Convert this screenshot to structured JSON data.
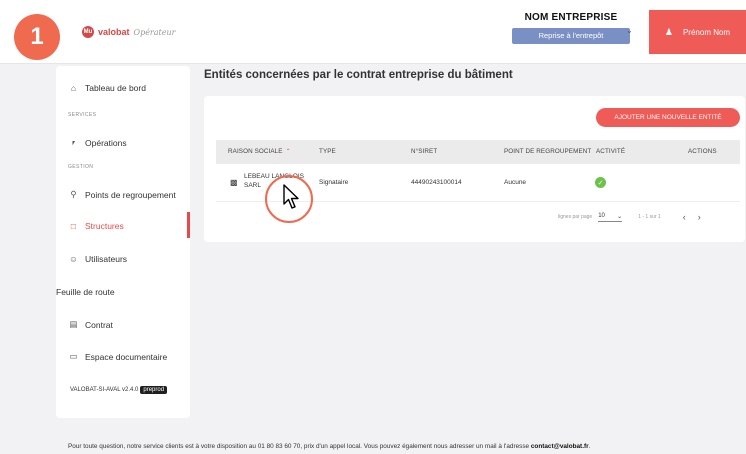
{
  "step_number": "1",
  "logo": {
    "brand": "valobat",
    "mark": "Mu",
    "subtitle": "Opérateur"
  },
  "header": {
    "company_name": "NOM ENTREPRISE",
    "reprise_label": "Reprise à l'entrepôt",
    "user_name": "Prénom Nom"
  },
  "sidebar": {
    "dashboard": "Tableau de bord",
    "section_services": "SERVICES",
    "operations": "Opérations",
    "section_gestion": "GESTION",
    "points": "Points de regroupement",
    "structures": "Structures",
    "users": "Utilisateurs",
    "roadmap": "Feuille de route",
    "contract": "Contrat",
    "documents": "Espace documentaire",
    "version": "VALOBAT-SI-AVAL v2.4.0",
    "version_tag": "preprod"
  },
  "main": {
    "title": "Entités concernées par le contrat entreprise du bâtiment",
    "add_button": "AJOUTER UNE NOUVELLE ENTITÉ",
    "columns": [
      "RAISON SOCIALE",
      "TYPE",
      "N°SIRET",
      "POINT DE REGROUPEMENT",
      "ACTIVITÉ",
      "ACTIONS"
    ],
    "rows": [
      {
        "raison_sociale": "LEBEAU LANGLOIS SARL",
        "type": "Signataire",
        "siret": "44490243100014",
        "point": "Aucune",
        "activite": "active"
      }
    ],
    "pagination": {
      "rows_per_page_label": "lignes par page",
      "rows_per_page": "10",
      "range": "1 - 1 sur 1"
    }
  },
  "footer": {
    "text": "Pour toute question, notre service clients est à votre disposition au 01 80 83 60 70, prix d'un appel local. Vous pouvez également nous adresser un mail à l'adresse ",
    "email": "contact@valobat.fr",
    "end": "."
  },
  "colors": {
    "accent": "#ef5b56",
    "reprise": "#7a8fc4",
    "badge": "#f06a50",
    "success": "#6cc24a"
  }
}
